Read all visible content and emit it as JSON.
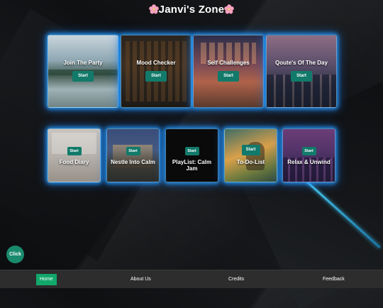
{
  "header": {
    "title": "Janvi's Zone",
    "icon": "cherry-blossom-icon"
  },
  "row1": [
    {
      "label": "Join The Party",
      "button": "Start",
      "image": "misty-lake-icon"
    },
    {
      "label": "Mood Checker",
      "button": "Start",
      "image": "library-icon"
    },
    {
      "label": "Self Challenges",
      "button": "Start",
      "image": "cozy-cafe-icon"
    },
    {
      "label": "Qoute's Of The Day",
      "button": "Start",
      "image": "city-window-icon"
    }
  ],
  "row2": [
    {
      "label": "Food Diary",
      "button": "Start",
      "image": "kitchen-icon"
    },
    {
      "label": "Nestle Into Calm",
      "button": "Start",
      "image": "house-at-dusk-icon"
    },
    {
      "label": "PlayList: Calm Jam",
      "button": "Start",
      "image": "dark-screen-icon"
    },
    {
      "label": "To-Do-List",
      "button": "Start",
      "image": "girl-reading-icon"
    },
    {
      "label": "Relax & Unwind",
      "button": "Start",
      "image": "purple-city-icon"
    }
  ],
  "floating_button": {
    "label": "Click"
  },
  "nav": {
    "items": [
      {
        "label": "Home",
        "active": true
      },
      {
        "label": "About Us"
      },
      {
        "label": "Credits"
      },
      {
        "label": "Feedback"
      }
    ]
  },
  "colors": {
    "accent": "#127a6a",
    "glow": "#28a0ff",
    "nav_active": "#12a86b",
    "navbar": "#2d2d2d"
  }
}
